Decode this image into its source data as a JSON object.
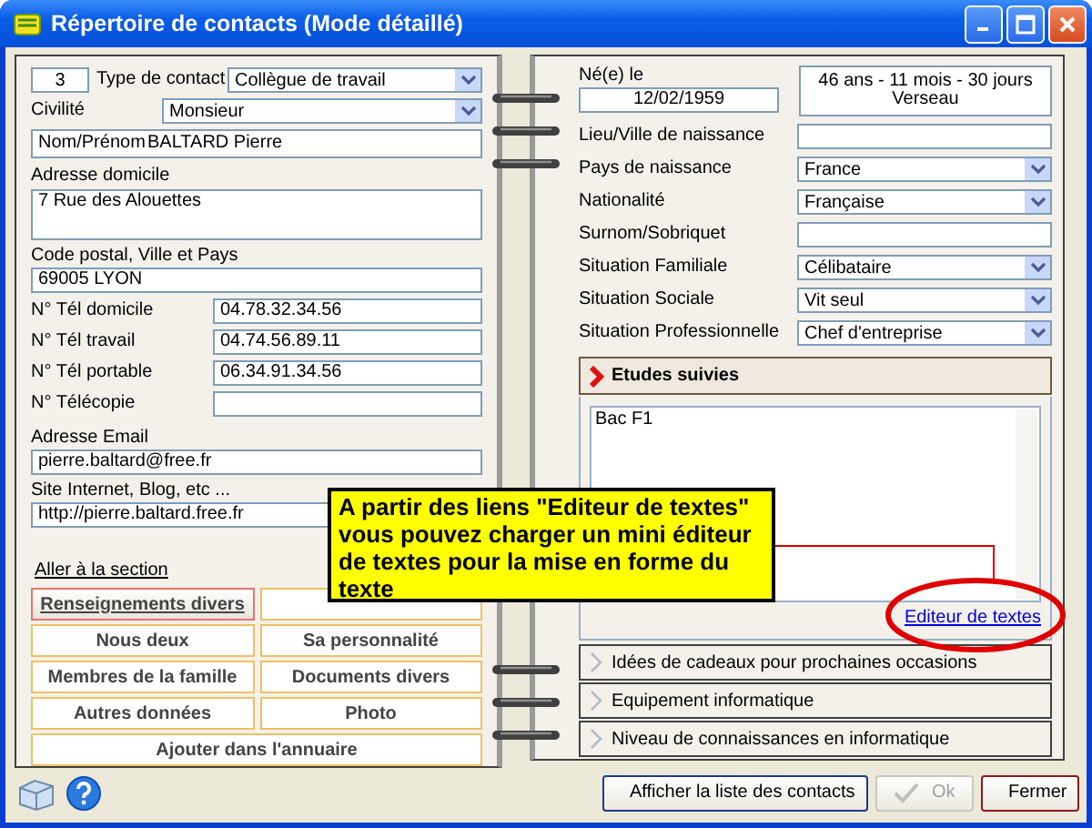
{
  "window": {
    "title": "Répertoire de contacts (Mode détaillé)"
  },
  "left": {
    "contact_number": "3",
    "contact_type": {
      "label": "Type de contact",
      "value": "Collègue de travail"
    },
    "civility": {
      "label": "Civilité",
      "value": "Monsieur"
    },
    "name": {
      "label": "Nom/Prénom",
      "value": "BALTARD Pierre"
    },
    "home_address": {
      "label": "Adresse domicile",
      "value": "7 Rue des Alouettes"
    },
    "postal": {
      "label": "Code postal, Ville et Pays",
      "value": "69005 LYON"
    },
    "phones": [
      {
        "label": "N° Tél domicile",
        "value": "04.78.32.34.56"
      },
      {
        "label": "N° Tél travail",
        "value": "04.74.56.89.11"
      },
      {
        "label": "N° Tél portable",
        "value": "06.34.91.34.56"
      },
      {
        "label": "N° Télécopie"
      }
    ],
    "email": {
      "label": "Adresse Email",
      "value": "pierre.baltard@free.fr"
    },
    "website": {
      "label": "Site Internet, Blog, etc ...",
      "value": "http://pierre.baltard.free.fr"
    },
    "section_link": "Aller à la section",
    "section_buttons": [
      {
        "label": "Renseignements divers",
        "selected": true
      },
      {
        "selected": false
      },
      {
        "label": "Nous deux",
        "selected": false
      },
      {
        "label": "Sa personnalité",
        "selected": false
      },
      {
        "label": "Membres de la famille",
        "selected": false
      },
      {
        "label": "Documents divers",
        "selected": false
      },
      {
        "label": "Autres données",
        "selected": false
      },
      {
        "label": "Photo",
        "selected": false
      },
      {
        "label": "Ajouter dans l'annuaire",
        "selected": false,
        "wide": true
      }
    ]
  },
  "right": {
    "birth": {
      "label": "Né(e) le",
      "value": "12/02/1959"
    },
    "age_lines": [
      "46 ans - 11 mois - 30 jours",
      "Verseau"
    ],
    "fields": [
      {
        "kind": "text",
        "label": "Lieu/Ville de naissance"
      },
      {
        "kind": "select",
        "label": "Pays de naissance",
        "value": "France"
      },
      {
        "kind": "select",
        "label": "Nationalité",
        "value": "Française"
      },
      {
        "kind": "text",
        "label": "Surnom/Sobriquet"
      },
      {
        "kind": "select",
        "label": "Situation Familiale",
        "value": "Célibataire"
      },
      {
        "kind": "select",
        "label": "Situation Sociale",
        "value": "Vit seul"
      },
      {
        "kind": "select",
        "label": "Situation Professionnelle",
        "value": "Chef d'entreprise"
      }
    ],
    "sections": [
      {
        "title": "Etudes suivies",
        "expanded": true,
        "text": "Bac F1",
        "link": "Editeur de textes"
      },
      {
        "title": "Idées de cadeaux pour prochaines occasions",
        "expanded": false
      },
      {
        "title": "Equipement informatique",
        "expanded": false
      },
      {
        "title": "Niveau de connaissances en informatique",
        "expanded": false
      }
    ]
  },
  "footer_buttons": [
    {
      "kind": "list",
      "label": "Afficher la liste des contacts",
      "disabled": false
    },
    {
      "kind": "ok",
      "label": "Ok",
      "disabled": true
    },
    {
      "kind": "close",
      "label": "Fermer",
      "disabled": false
    }
  ],
  "callout": "A partir des liens \"Editeur de textes\" vous pouvez charger un mini éditeur de textes pour la mise en forme du texte"
}
